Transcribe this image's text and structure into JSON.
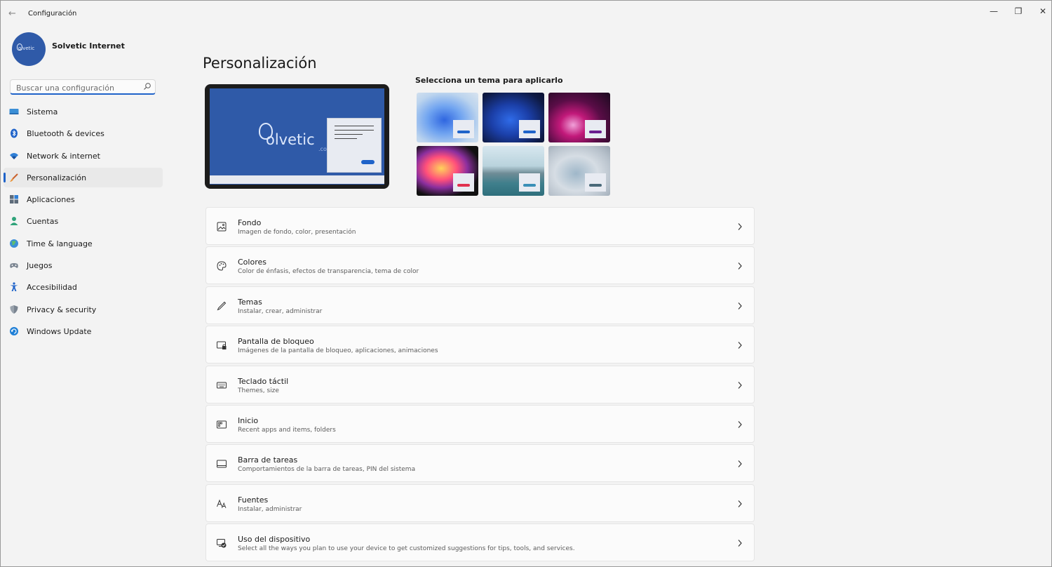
{
  "window": {
    "title": "Configuración",
    "back_glyph": "←",
    "minimize_glyph": "—",
    "maximize_glyph": "❐",
    "close_glyph": "✕"
  },
  "profile": {
    "name": "Solvetic Internet",
    "avatar_text": "olvetic"
  },
  "search": {
    "placeholder": "Buscar una configuración",
    "icon": "search-icon"
  },
  "sidebar": {
    "items": [
      {
        "label": "Sistema",
        "icon": "monitor-icon",
        "active": false
      },
      {
        "label": "Bluetooth & devices",
        "icon": "bluetooth-icon",
        "active": false
      },
      {
        "label": "Network & internet",
        "icon": "wifi-icon",
        "active": false
      },
      {
        "label": "Personalización",
        "icon": "brush-icon",
        "active": true
      },
      {
        "label": "Aplicaciones",
        "icon": "apps-icon",
        "active": false
      },
      {
        "label": "Cuentas",
        "icon": "person-icon",
        "active": false
      },
      {
        "label": "Time & language",
        "icon": "globe-clock-icon",
        "active": false
      },
      {
        "label": "Juegos",
        "icon": "gamepad-icon",
        "active": false
      },
      {
        "label": "Accesibilidad",
        "icon": "accessibility-icon",
        "active": false
      },
      {
        "label": "Privacy & security",
        "icon": "shield-icon",
        "active": false
      },
      {
        "label": "Windows Update",
        "icon": "update-icon",
        "active": false
      }
    ]
  },
  "main": {
    "title": "Personalización",
    "preview": {
      "brand": "olvetic",
      "brand_suffix": ".co"
    },
    "themes_label": "Selecciona un tema para aplicarlo",
    "themes": [
      {
        "name": "light-bloom",
        "accent": "#1f63c9"
      },
      {
        "name": "dark-bloom",
        "accent": "#1f63c9"
      },
      {
        "name": "glow",
        "accent": "#6b1d8f"
      },
      {
        "name": "captured-motion",
        "accent": "#e0314f"
      },
      {
        "name": "sunrise-lake",
        "accent": "#3a8fb7"
      },
      {
        "name": "flow",
        "accent": "#4a6a7a"
      }
    ],
    "settings": [
      {
        "title": "Fondo",
        "subtitle": "Imagen de fondo, color, presentación",
        "icon": "image-icon"
      },
      {
        "title": "Colores",
        "subtitle": "Color de énfasis, efectos de transparencia, tema de color",
        "icon": "palette-icon"
      },
      {
        "title": "Temas",
        "subtitle": "Instalar, crear, administrar",
        "icon": "pen-icon"
      },
      {
        "title": "Pantalla de bloqueo",
        "subtitle": "Imágenes de la pantalla de bloqueo, aplicaciones, animaciones",
        "icon": "lock-screen-icon"
      },
      {
        "title": "Teclado táctil",
        "subtitle": "Themes, size",
        "icon": "keyboard-icon"
      },
      {
        "title": "Inicio",
        "subtitle": "Recent apps and items, folders",
        "icon": "start-icon"
      },
      {
        "title": "Barra de tareas",
        "subtitle": "Comportamientos de la barra de tareas, PIN del sistema",
        "icon": "taskbar-icon"
      },
      {
        "title": "Fuentes",
        "subtitle": "Instalar, administrar",
        "icon": "fonts-icon"
      },
      {
        "title": "Uso del dispositivo",
        "subtitle": "Select all the ways you plan to use your device to get customized suggestions for tips, tools, and services.",
        "icon": "device-usage-icon"
      }
    ]
  },
  "colors": {
    "accent": "#1f63c9",
    "window_bg": "#f3f3f3",
    "card_bg": "#fbfbfb"
  }
}
